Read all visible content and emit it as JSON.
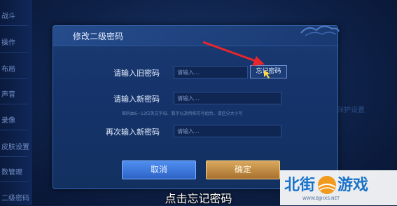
{
  "sidebar": {
    "items": [
      "战斗",
      "操作",
      "布局",
      "声音",
      "录像",
      "皮肤设置",
      "数管理",
      "二级密码"
    ]
  },
  "right_faint_text": "保护设置",
  "dialog": {
    "title": "修改二级密码",
    "old_password": {
      "label": "请输入旧密码",
      "placeholder": "请输入..."
    },
    "forgot_button": "忘记密码",
    "new_password": {
      "label": "请输入新密码",
      "placeholder": "请输入..."
    },
    "hint": "密码由6~12位英文字母、数字以及特殊符号组合，请区分大小写",
    "confirm_password": {
      "label": "再次输入新密码",
      "placeholder": "请输入..."
    },
    "cancel_button": "取消",
    "confirm_button": "确定"
  },
  "caption": "点击忘记密码",
  "watermark": {
    "left": "北街",
    "right": "游戏",
    "url": "WWW.BJJHXS.NET"
  },
  "colors": {
    "cancel": "#3d7be0",
    "confirm": "#c28a45",
    "arrow": "#e8262a",
    "watermark": "#1a73c9"
  }
}
